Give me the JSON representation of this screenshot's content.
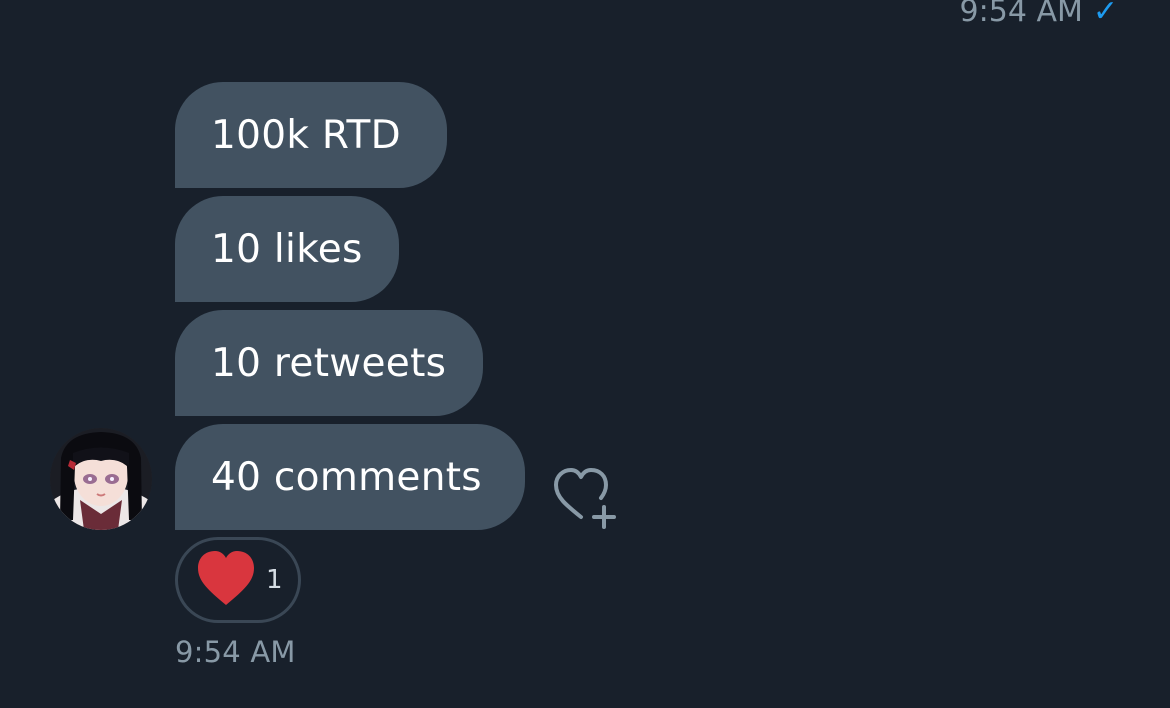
{
  "header": {
    "time": "9:54 AM",
    "status_icon": "check-icon",
    "status_color": "#1d9bf0"
  },
  "messages": [
    {
      "text": "100k RTD"
    },
    {
      "text": "10 likes"
    },
    {
      "text": "10 retweets"
    },
    {
      "text": "40 comments"
    }
  ],
  "reaction": {
    "icon": "heart-icon",
    "count": "1",
    "color": "#d9363e"
  },
  "actions": {
    "add_reaction_icon": "heart-plus-icon"
  },
  "footer": {
    "time": "9:54 AM"
  },
  "colors": {
    "background": "#18202b",
    "bubble": "#425261",
    "muted_text": "#8899a6"
  }
}
